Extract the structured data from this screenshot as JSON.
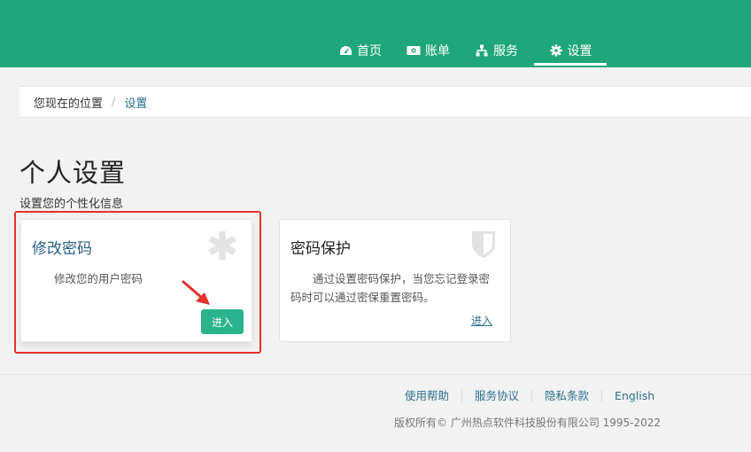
{
  "nav": {
    "items": [
      {
        "label": "首页",
        "icon": "dashboard-icon"
      },
      {
        "label": "账单",
        "icon": "money-icon"
      },
      {
        "label": "服务",
        "icon": "sitemap-icon"
      },
      {
        "label": "设置",
        "icon": "gear-icon",
        "active": true
      }
    ]
  },
  "breadcrumb": {
    "root": "您现在的位置",
    "separator": "/",
    "current": "设置"
  },
  "page": {
    "title": "个人设置",
    "subtitle": "设置您的个性化信息"
  },
  "cards": [
    {
      "title": "修改密码",
      "desc": "修改您的用户密码",
      "action": "进入",
      "icon": "asterisk-icon"
    },
    {
      "title": "密码保护",
      "desc": "通过设置密码保护，当您忘记登录密码时可以通过密保重置密码。",
      "action": "进入",
      "icon": "shield-icon"
    }
  ],
  "footer": {
    "links": [
      "使用帮助",
      "服务协议",
      "隐私条款",
      "English"
    ],
    "copyright": "版权所有© 广州热点软件科技股份有限公司 1995-2022"
  },
  "colors": {
    "header": "#1fa67a",
    "accent_button": "#2bb38b",
    "link": "#2c6f8f",
    "highlight": "#e5322d"
  }
}
